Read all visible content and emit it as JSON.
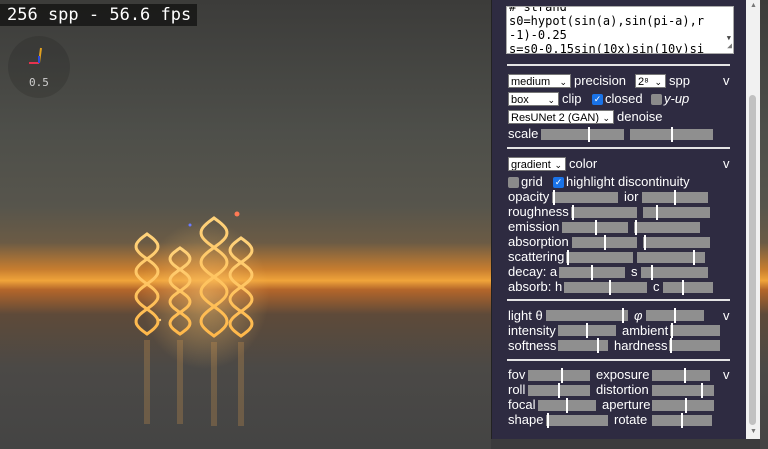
{
  "viewport": {
    "stats": "256 spp - 56.6 fps",
    "zoom": "0.5",
    "gizmo_colors": {
      "x": "#e5334f",
      "y": "#2f4bdc",
      "z": "#e0a020"
    }
  },
  "code_editor": {
    "lines": [
      "# strand",
      "s0=hypot(sin(a),sin(pi-a),r",
      "-1)-0.25",
      "s=s0-0.15sin(10x)sin(10y)si"
    ]
  },
  "render": {
    "precision_value": "medium",
    "precision_label": "precision",
    "spp_value": "2⁸",
    "spp_label": "spp",
    "collapse": "v",
    "clip_value": "box",
    "clip_label": "clip",
    "closed_label": "closed",
    "closed_checked": true,
    "yup_label": "y-up",
    "yup_checked": false,
    "denoise_value": "ResUNet 2 (GAN)",
    "denoise_label": "denoise",
    "scale_label": "scale",
    "scale_levels": [
      0.58,
      0.5
    ]
  },
  "material": {
    "color_value": "gradient",
    "color_label": "color",
    "collapse": "v",
    "grid_label": "grid",
    "grid_checked": false,
    "highlight_label": "highlight discontinuity",
    "highlight_checked": true,
    "sliders": [
      {
        "label": "opacity",
        "level": 0.02,
        "label2": "ior",
        "level2": 0.5
      },
      {
        "label": "roughness",
        "level": 0.02,
        "label2": "",
        "level2": 0.2
      },
      {
        "label": "emission",
        "level": 0.52,
        "label2": "",
        "level2": 0.02
      },
      {
        "label": "absorption",
        "level": 0.5,
        "label2": "",
        "level2": 0.02
      },
      {
        "label": "scattering",
        "level": 0.02,
        "label2": "",
        "level2": 0.85
      },
      {
        "label": "decay: a",
        "level": 0.5,
        "label2": "s",
        "level2": 0.15
      },
      {
        "label": "absorb: h",
        "level": 0.55,
        "label2": "c",
        "level2": 0.4
      }
    ]
  },
  "light": {
    "theta_label": "light θ",
    "theta_level": 0.95,
    "phi_label": "φ",
    "phi_level": 0.5,
    "collapse": "v",
    "intensity_label": "intensity",
    "intensity_level": 0.5,
    "ambient_label": "ambient",
    "ambient_level": 0.02,
    "softness_label": "softness",
    "softness_level": 0.82,
    "hardness_label": "hardness",
    "hardness_level": 0.02
  },
  "camera": {
    "collapse": "v",
    "fov_label": "fov",
    "fov_level": 0.55,
    "exposure_label": "exposure",
    "exposure_level": 0.57,
    "roll_label": "roll",
    "roll_level": 0.5,
    "distortion_label": "distortion",
    "distortion_level": 0.82,
    "focal_label": "focal",
    "focal_level": 0.5,
    "aperture_label": "aperture",
    "aperture_level": 0.55,
    "shape_label": "shape",
    "shape_level": 0.02,
    "rotate_label": "rotate",
    "rotate_level": 0.5
  }
}
